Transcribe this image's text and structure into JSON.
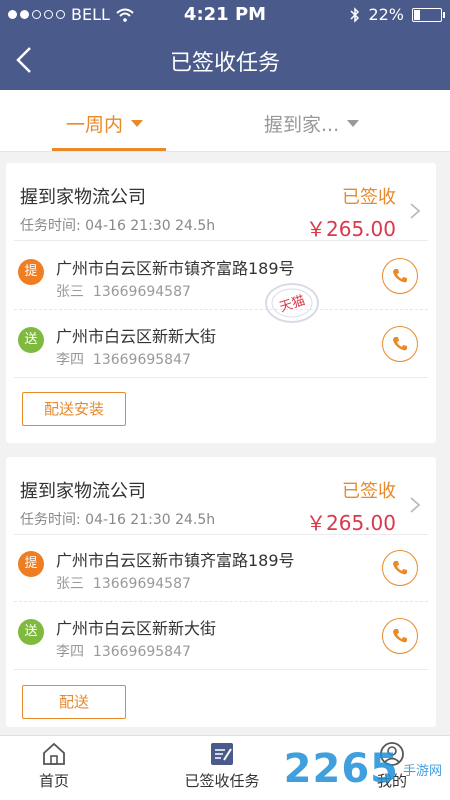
{
  "status_bar": {
    "carrier": "BELL",
    "time": "4:21 PM",
    "battery": "22%",
    "battery_level": 0.22
  },
  "nav": {
    "title": "已签收任务",
    "back_icon": "chevron-left-icon"
  },
  "filters": [
    {
      "label": "一周内",
      "active": true
    },
    {
      "label": "握到家...",
      "active": false
    }
  ],
  "tasks": [
    {
      "company": "握到家物流公司",
      "status": "已签收",
      "time_label": "任务时间:",
      "time": "04-16 21:30",
      "duration": "24.5h",
      "price": "￥265.00",
      "pickup": {
        "badge": "提",
        "address": "广州市白云区新市镇齐富路189号",
        "contact": "张三",
        "phone": "13669694587"
      },
      "delivery": {
        "badge": "送",
        "address": "广州市白云区新新大街",
        "contact": "李四",
        "phone": "13669695847"
      },
      "action": "配送安装"
    },
    {
      "company": "握到家物流公司",
      "status": "已签收",
      "time_label": "任务时间:",
      "time": "04-16 21:30",
      "duration": "24.5h",
      "price": "￥265.00",
      "pickup": {
        "badge": "提",
        "address": "广州市白云区新市镇齐富路189号",
        "contact": "张三",
        "phone": "13669694587"
      },
      "delivery": {
        "badge": "送",
        "address": "广州市白云区新新大街",
        "contact": "李四",
        "phone": "13669695847"
      },
      "action": "配送"
    }
  ],
  "stamp": {
    "text": "天猫"
  },
  "tabs": [
    {
      "label": "首页",
      "icon": "home-icon"
    },
    {
      "label": "已签收任务",
      "icon": "signed-tasks-icon"
    },
    {
      "label": "我的",
      "icon": "user-icon"
    }
  ],
  "watermark": {
    "number": "2265",
    "text": "手游网"
  },
  "colors": {
    "header": "#4a5a8b",
    "accent": "#e8892a",
    "price": "#d9394a",
    "pickup_badge": "#ef7d22",
    "delivery_badge": "#7fba3f"
  }
}
